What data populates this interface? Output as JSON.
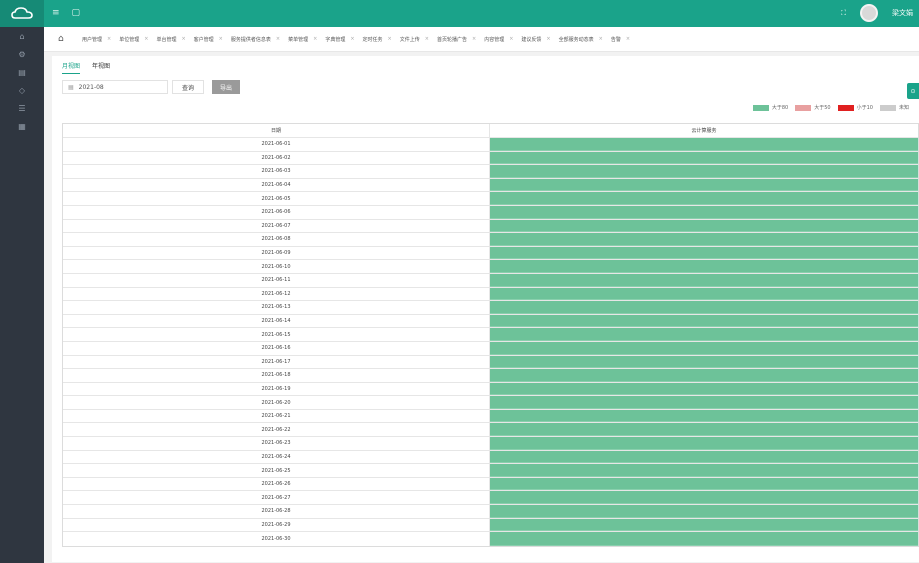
{
  "topbar": {
    "icons": [
      "menu-icon",
      "window-icon"
    ],
    "user_name": "梁文娟",
    "colors": {
      "bar": "#1aa38a"
    }
  },
  "sidebar": {
    "items": [
      "home-icon",
      "settings-icon",
      "grid-icon",
      "layers-icon",
      "list-icon",
      "chart-icon"
    ]
  },
  "tabs": [
    {
      "label": "用户管理"
    },
    {
      "label": "单位管理"
    },
    {
      "label": "单台管理"
    },
    {
      "label": "客户管理"
    },
    {
      "label": "服务提供者信息表"
    },
    {
      "label": "菜单管理"
    },
    {
      "label": "字典管理"
    },
    {
      "label": "定时任务"
    },
    {
      "label": "文件上传"
    },
    {
      "label": "首页轮播广告"
    },
    {
      "label": "内容管理"
    },
    {
      "label": "建议反馈"
    },
    {
      "label": "全部服务动态表"
    },
    {
      "label": "告警"
    }
  ],
  "view": {
    "tabs": [
      "月视图",
      "年视图"
    ],
    "active_tab": "月视图",
    "month_value": "2021-08",
    "query_label": "查询",
    "export_label": "导出"
  },
  "legend": [
    {
      "label": "大于80",
      "color": "#6dc299"
    },
    {
      "label": "大于50",
      "color": "#e8a0a0"
    },
    {
      "label": "小于10",
      "color": "#e02020"
    },
    {
      "label": "未知",
      "color": "#cccccc"
    }
  ],
  "table": {
    "headers": [
      "日期",
      "云计算服务"
    ],
    "rows": [
      "2021-06-01",
      "2021-06-02",
      "2021-06-03",
      "2021-06-04",
      "2021-06-05",
      "2021-06-06",
      "2021-06-07",
      "2021-06-08",
      "2021-06-09",
      "2021-06-10",
      "2021-06-11",
      "2021-06-12",
      "2021-06-13",
      "2021-06-14",
      "2021-06-15",
      "2021-06-16",
      "2021-06-17",
      "2021-06-18",
      "2021-06-19",
      "2021-06-20",
      "2021-06-21",
      "2021-06-22",
      "2021-06-23",
      "2021-06-24",
      "2021-06-25",
      "2021-06-26",
      "2021-06-27",
      "2021-06-28",
      "2021-06-29",
      "2021-06-30"
    ]
  }
}
